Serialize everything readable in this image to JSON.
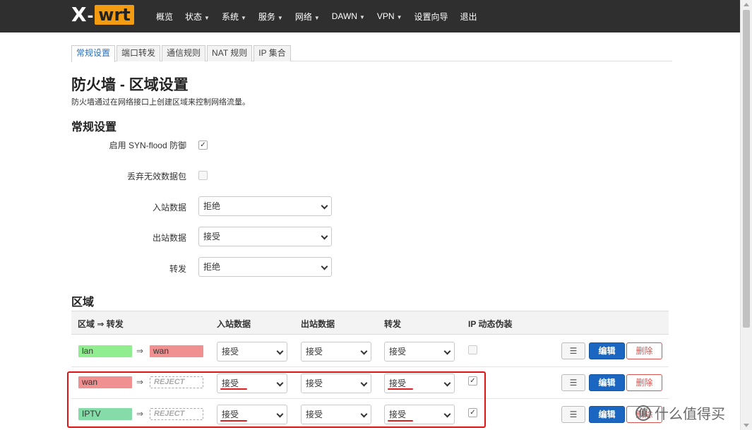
{
  "brand": {
    "x": "X",
    "dash": "-",
    "wrt": "wrt",
    "accent_color": "#f39c12"
  },
  "nav": [
    {
      "label": "概览",
      "dropdown": false
    },
    {
      "label": "状态",
      "dropdown": true
    },
    {
      "label": "系统",
      "dropdown": true
    },
    {
      "label": "服务",
      "dropdown": true
    },
    {
      "label": "网络",
      "dropdown": true
    },
    {
      "label": "DAWN",
      "dropdown": true
    },
    {
      "label": "VPN",
      "dropdown": true
    },
    {
      "label": "设置向导",
      "dropdown": false
    },
    {
      "label": "退出",
      "dropdown": false
    }
  ],
  "tabs": [
    {
      "label": "常规设置",
      "active": true
    },
    {
      "label": "端口转发",
      "active": false
    },
    {
      "label": "通信规则",
      "active": false
    },
    {
      "label": "NAT 规则",
      "active": false
    },
    {
      "label": "IP 集合",
      "active": false
    }
  ],
  "page": {
    "title": "防火墙 - 区域设置",
    "description": "防火墙通过在网络接口上创建区域来控制网络流量。"
  },
  "general": {
    "title": "常规设置",
    "syn_flood_label": "启用 SYN-flood 防御",
    "syn_flood_checked": true,
    "drop_invalid_label": "丢弃无效数据包",
    "drop_invalid_checked": false,
    "input_label": "入站数据",
    "input_value": "拒绝",
    "output_label": "出站数据",
    "output_value": "接受",
    "forward_label": "转发",
    "forward_value": "拒绝"
  },
  "zones": {
    "title": "区域",
    "headers": {
      "zone": "区域 ⇒ 转发",
      "input": "入站数据",
      "output": "出站数据",
      "forward": "转发",
      "masq": "IP 动态伪装"
    },
    "arrow": "⇒",
    "rows": [
      {
        "name": "lan",
        "name_color": "#90ee90",
        "target": "wan",
        "target_color": "#f09090",
        "target_reject": false,
        "input": "接受",
        "output": "接受",
        "forward": "接受",
        "masq": false
      },
      {
        "name": "wan",
        "name_color": "#f09090",
        "target": "REJECT",
        "target_color": "",
        "target_reject": true,
        "input": "接受",
        "output": "接受",
        "forward": "接受",
        "masq": true
      },
      {
        "name": "IPTV",
        "name_color": "#86dca8",
        "target": "REJECT",
        "target_color": "",
        "target_reject": true,
        "input": "接受",
        "output": "接受",
        "forward": "接受",
        "masq": true
      }
    ],
    "buttons": {
      "menu": "☰",
      "edit": "编辑",
      "delete": "删除"
    }
  },
  "watermark": {
    "text": "什么值得买",
    "logo": "值"
  }
}
